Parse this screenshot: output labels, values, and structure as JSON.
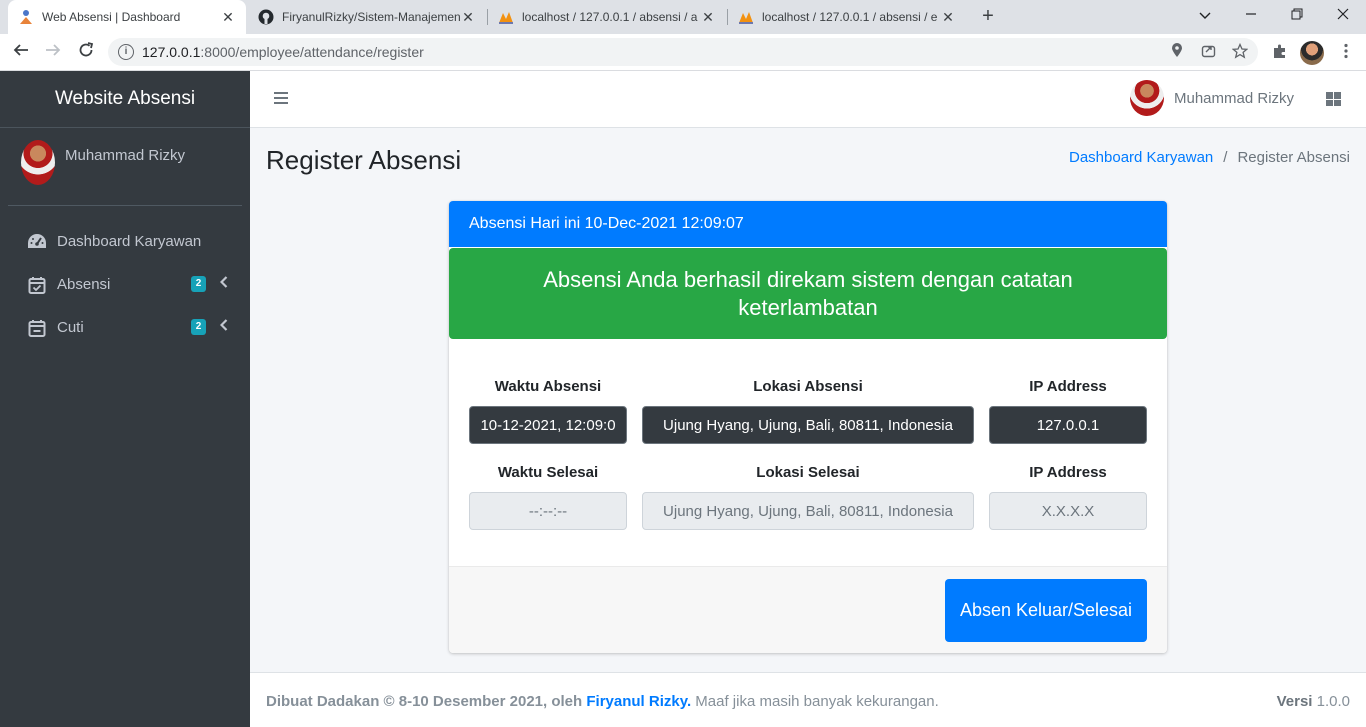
{
  "browser": {
    "tabs": [
      {
        "title": "Web Absensi | Dashboard",
        "active": true
      },
      {
        "title": "FiryanulRizky/Sistem-Manajemen",
        "active": false
      },
      {
        "title": "localhost / 127.0.0.1 / absensi / a",
        "active": false
      },
      {
        "title": "localhost / 127.0.0.1 / absensi / e",
        "active": false
      }
    ],
    "close_glyph": "✕",
    "new_tab_glyph": "+",
    "url_host": "127.0.0.1",
    "url_rest": ":8000/employee/attendance/register"
  },
  "sidebar": {
    "brand": "Website Absensi",
    "user_name": "Muhammad Rizky",
    "items": [
      {
        "label": "Dashboard Karyawan",
        "icon": "tachometer-icon"
      },
      {
        "label": "Absensi",
        "icon": "calendar-check-icon",
        "badge": "2"
      },
      {
        "label": "Cuti",
        "icon": "calendar-minus-icon",
        "badge": "2"
      }
    ]
  },
  "navbar": {
    "user_name": "Muhammad Rizky"
  },
  "page": {
    "title": "Register Absensi",
    "breadcrumb": [
      {
        "label": "Dashboard Karyawan"
      },
      {
        "label": "Register Absensi"
      }
    ],
    "breadcrumb_sep": "/"
  },
  "card": {
    "header": "Absensi Hari ini 10-Dec-2021 12:09:07",
    "alert": "Absensi Anda berhasil direkam sistem dengan catatan keterlambatan",
    "checkin": {
      "time_label": "Waktu Absensi",
      "time_value": "10-12-2021,  12:09:0",
      "location_label": "Lokasi Absensi",
      "location_value": "Ujung Hyang, Ujung, Bali, 80811, Indonesia",
      "ip_label": "IP Address",
      "ip_value": "127.0.0.1"
    },
    "checkout": {
      "time_label": "Waktu Selesai",
      "time_placeholder": "--:--:--",
      "location_label": "Lokasi Selesai",
      "location_value": "Ujung Hyang, Ujung, Bali, 80811, Indonesia",
      "ip_label": "IP Address",
      "ip_placeholder": "X.X.X.X"
    },
    "button": "Absen Keluar/Selesai"
  },
  "footer": {
    "made": "Dibuat Dadakan © 8-10 Desember 2021, oleh",
    "author": "Firyanul Rizky.",
    "note": " Maaf jika masih banyak kekurangan.",
    "version_label": "Versi",
    "version": " 1.0.0"
  },
  "colors": {
    "primary": "#007bff",
    "success": "#28a745",
    "sidebar": "#343a40",
    "badge": "#17a2b8"
  }
}
